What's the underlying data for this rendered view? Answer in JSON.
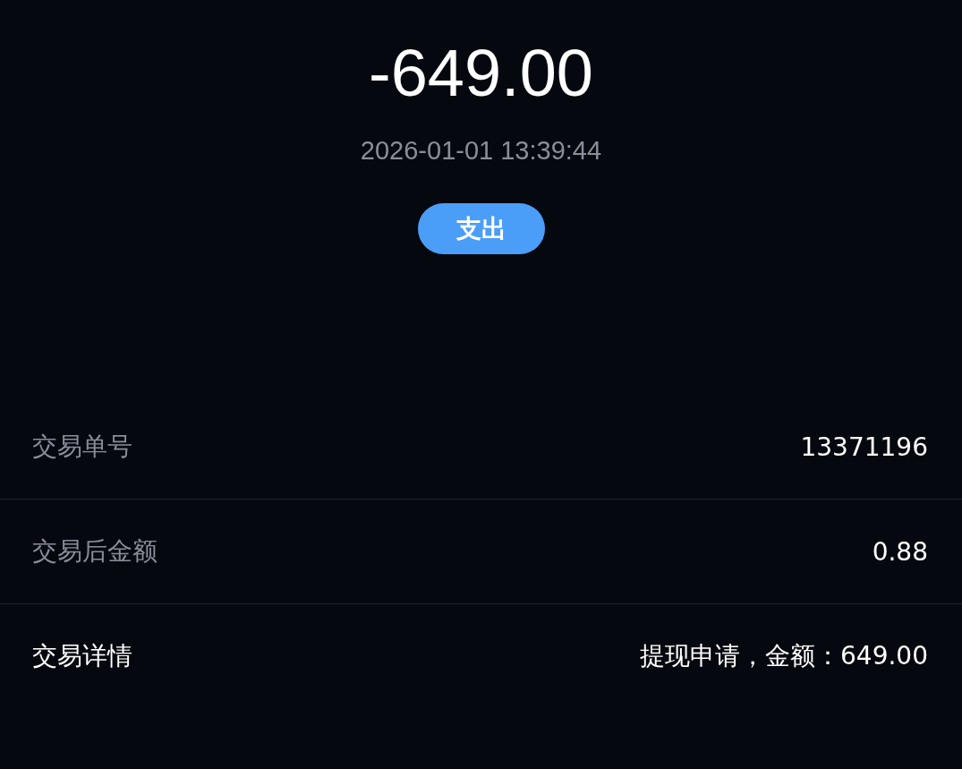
{
  "amount": "-649.00",
  "datetime": "2026-01-01 13:39:44",
  "type_badge": "支出",
  "details": [
    {
      "label": "交易单号",
      "value": "13371196",
      "highlighted": false
    },
    {
      "label": "交易后金额",
      "value": "0.88",
      "highlighted": false
    },
    {
      "label": "交易详情",
      "value": "提现申请，金额：649.00",
      "highlighted": true
    }
  ]
}
